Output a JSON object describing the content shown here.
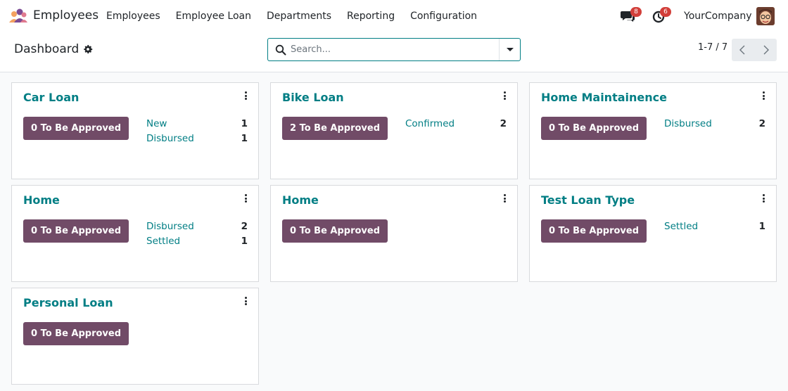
{
  "navbar": {
    "app_name": "Employees",
    "menu": [
      "Employees",
      "Employee Loan",
      "Departments",
      "Reporting",
      "Configuration"
    ],
    "messages_badge": "8",
    "activities_badge": "6",
    "company": "YourCompany"
  },
  "control": {
    "breadcrumb": "Dashboard",
    "search_placeholder": "Search...",
    "pager": "1-7 / 7"
  },
  "colors": {
    "accent": "#017e84",
    "button": "#714b67",
    "badge": "#d23f3a"
  },
  "cards": [
    {
      "title": "Car Loan",
      "button": "0 To Be Approved",
      "statuses": [
        {
          "label": "New",
          "count": "1"
        },
        {
          "label": "Disbursed",
          "count": "1"
        }
      ]
    },
    {
      "title": "Bike Loan",
      "button": "2 To Be Approved",
      "statuses": [
        {
          "label": "Confirmed",
          "count": "2"
        }
      ]
    },
    {
      "title": "Home Maintainence",
      "button": "0 To Be Approved",
      "statuses": [
        {
          "label": "Disbursed",
          "count": "2"
        }
      ]
    },
    {
      "title": "Home",
      "button": "0 To Be Approved",
      "statuses": [
        {
          "label": "Disbursed",
          "count": "2"
        },
        {
          "label": "Settled",
          "count": "1"
        }
      ]
    },
    {
      "title": "Home",
      "button": "0 To Be Approved",
      "statuses": []
    },
    {
      "title": "Test Loan Type",
      "button": "0 To Be Approved",
      "statuses": [
        {
          "label": "Settled",
          "count": "1"
        }
      ]
    },
    {
      "title": "Personal Loan",
      "button": "0 To Be Approved",
      "statuses": []
    }
  ]
}
